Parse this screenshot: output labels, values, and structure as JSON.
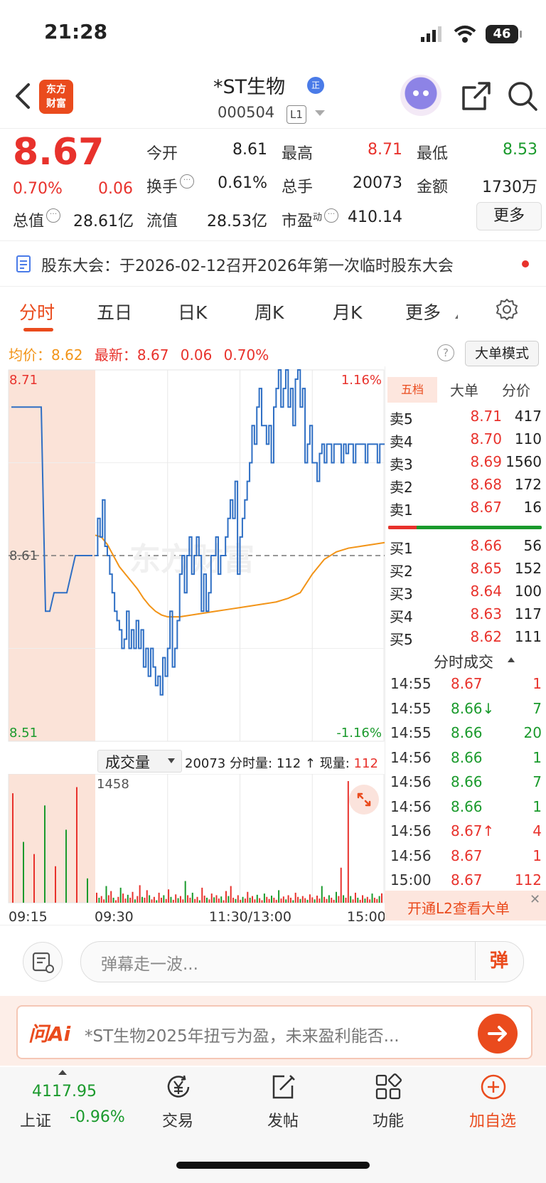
{
  "status_bar": {
    "time": "21:28",
    "battery": "46"
  },
  "header": {
    "logo_text": "东方\n财富",
    "title": "*ST生物",
    "title_badge": "正",
    "code": "000504",
    "level_badge": "L1"
  },
  "quote": {
    "price": "8.67",
    "change_pct": "0.70%",
    "change_amt": "0.06",
    "fields": {
      "open": {
        "label": "今开",
        "value": "8.61"
      },
      "high": {
        "label": "最高",
        "value": "8.71"
      },
      "low": {
        "label": "最低",
        "value": "8.53"
      },
      "turnover_rate": {
        "label": "换手",
        "value": "0.61%"
      },
      "volume": {
        "label": "总手",
        "value": "20073"
      },
      "amount": {
        "label": "金额",
        "value": "1730万"
      },
      "total_mkt_cap": {
        "label": "总值",
        "value": "28.61亿"
      },
      "float_mkt_cap": {
        "label": "流值",
        "value": "28.53亿"
      },
      "pe": {
        "label": "市盈",
        "label_sup": "动",
        "value": "410.14"
      }
    },
    "more_label": "更多"
  },
  "notice": {
    "text": "股东大会：于2026-02-12召开2026年第一次临时股东大会"
  },
  "tabs": [
    "分时",
    "五日",
    "日K",
    "周K",
    "月K",
    "更多"
  ],
  "chart_header": {
    "avg_label": "均价：",
    "avg_value": "8.62",
    "latest_label": "最新：",
    "latest_value": "8.67",
    "latest_chg": "0.06",
    "latest_pct": "0.70%",
    "info_icon": "?",
    "big_order_label": "大单模式"
  },
  "chart_data": {
    "type": "line",
    "y_max_label": "8.71",
    "y_mid_label": "8.61",
    "y_min_label": "8.51",
    "pct_max_label": "1.16%",
    "pct_min_label": "-1.16%",
    "ylim": [
      8.51,
      8.71
    ],
    "prev_close": 8.61,
    "watermark": "东方财富",
    "x_labels": [
      "09:15",
      "09:30",
      "11:30/13:00",
      "15:00"
    ],
    "series": [
      {
        "name": "均价",
        "color": "#f29418",
        "x": [
          0,
          5,
          10,
          15,
          20,
          25,
          30,
          35,
          40,
          45,
          50,
          55,
          60,
          70,
          80,
          90,
          100,
          110,
          120,
          130,
          140,
          150,
          160,
          170,
          180,
          190,
          200,
          210,
          220,
          230,
          240
        ],
        "values": [
          8.621,
          8.62,
          8.616,
          8.61,
          8.604,
          8.6,
          8.596,
          8.592,
          8.587,
          8.583,
          8.58,
          8.578,
          8.577,
          8.577,
          8.578,
          8.579,
          8.58,
          8.581,
          8.582,
          8.583,
          8.584,
          8.585,
          8.587,
          8.59,
          8.6,
          8.608,
          8.612,
          8.614,
          8.615,
          8.616,
          8.617
        ]
      },
      {
        "name": "最新",
        "color": "#2f6fc4",
        "x": [
          0,
          2,
          4,
          6,
          8,
          10,
          12,
          14,
          16,
          18,
          20,
          22,
          24,
          26,
          28,
          30,
          32,
          34,
          36,
          38,
          40,
          42,
          44,
          46,
          48,
          50,
          52,
          54,
          56,
          58,
          60,
          62,
          64,
          66,
          68,
          70,
          72,
          74,
          76,
          78,
          80,
          82,
          84,
          86,
          88,
          90,
          92,
          94,
          96,
          98,
          100,
          102,
          104,
          106,
          108,
          110,
          112,
          114,
          116,
          118,
          120,
          122,
          124,
          126,
          128,
          130,
          132,
          134,
          136,
          138,
          140,
          142,
          144,
          146,
          148,
          150,
          152,
          154,
          156,
          158,
          160,
          162,
          164,
          166,
          168,
          170,
          172,
          174,
          176,
          178,
          180,
          182,
          184,
          186,
          188,
          190,
          192,
          194,
          196,
          198,
          200,
          202,
          204,
          206,
          208,
          210,
          212,
          214,
          216,
          218,
          220,
          222,
          224,
          226,
          228,
          230,
          232,
          234,
          236,
          238,
          240
        ],
        "values": [
          8.61,
          8.63,
          8.62,
          8.64,
          8.615,
          8.61,
          8.6,
          8.59,
          8.58,
          8.575,
          8.57,
          8.56,
          8.565,
          8.58,
          8.56,
          8.57,
          8.56,
          8.575,
          8.56,
          8.57,
          8.55,
          8.56,
          8.545,
          8.56,
          8.55,
          8.54,
          8.545,
          8.535,
          8.555,
          8.545,
          8.56,
          8.58,
          8.55,
          8.56,
          8.575,
          8.6,
          8.61,
          8.59,
          8.61,
          8.62,
          8.6,
          8.61,
          8.62,
          8.61,
          8.58,
          8.6,
          8.58,
          8.59,
          8.61,
          8.61,
          8.62,
          8.6,
          8.61,
          8.61,
          8.62,
          8.63,
          8.64,
          8.63,
          8.65,
          8.6,
          8.62,
          8.63,
          8.64,
          8.65,
          8.66,
          8.68,
          8.67,
          8.69,
          8.7,
          8.68,
          8.68,
          8.67,
          8.68,
          8.66,
          8.69,
          8.7,
          8.71,
          8.69,
          8.7,
          8.71,
          8.69,
          8.7,
          8.68,
          8.705,
          8.71,
          8.69,
          8.7,
          8.66,
          8.67,
          8.68,
          8.66,
          8.66,
          8.65,
          8.665,
          8.67,
          8.66,
          8.67,
          8.67,
          8.66,
          8.67,
          8.67,
          8.67,
          8.66,
          8.67,
          8.665,
          8.67,
          8.67,
          8.66,
          8.67,
          8.67,
          8.67,
          8.67,
          8.66,
          8.67,
          8.67,
          8.67,
          8.67,
          8.66,
          8.67,
          8.67,
          8.67
        ]
      }
    ],
    "auction_values": [
      8.69,
      8.69,
      8.69,
      8.69,
      8.69,
      8.69,
      8.69,
      8.69,
      8.58,
      8.58,
      8.59,
      8.59,
      8.59,
      8.59,
      8.6,
      8.61,
      8.61,
      8.61,
      8.61,
      8.61
    ],
    "volume": {
      "label": "成交量",
      "total_value": "20073",
      "interval_label": "分时量:",
      "interval_value": "112",
      "current_label": "现量:",
      "current_value": "112",
      "max_label": "1458",
      "ymax": 1458,
      "bars": [
        120,
        60,
        80,
        40,
        200,
        90,
        140,
        60,
        30,
        70,
        180,
        110,
        50,
        95,
        60,
        130,
        40,
        80,
        210,
        70,
        60,
        150,
        90,
        40,
        70,
        30,
        120,
        60,
        90,
        45,
        160,
        70,
        35,
        100,
        55,
        80,
        40,
        260,
        90,
        60,
        120,
        45,
        70,
        30,
        180,
        85,
        60,
        40,
        110,
        65,
        90,
        50,
        75,
        30,
        140,
        80,
        200,
        60,
        45,
        90,
        35,
        70,
        50,
        130,
        60,
        80,
        40,
        95,
        55,
        30,
        110,
        70,
        45,
        85,
        60,
        35,
        150,
        50,
        75,
        40,
        90,
        60,
        30,
        120,
        70,
        45,
        80,
        55,
        35,
        100,
        65,
        40,
        85,
        50,
        200,
        70,
        45,
        90,
        60,
        35,
        130,
        80,
        420,
        90,
        60,
        1458,
        80,
        40,
        120,
        60,
        35,
        90,
        50,
        70,
        40,
        110,
        60,
        45,
        80,
        112
      ],
      "bar_colors": "alternating"
    }
  },
  "order_book": {
    "tabs": [
      "五档",
      "大单",
      "分价"
    ],
    "asks": [
      {
        "label": "卖5",
        "price": "8.71",
        "vol": "417"
      },
      {
        "label": "卖4",
        "price": "8.70",
        "vol": "110"
      },
      {
        "label": "卖3",
        "price": "8.69",
        "vol": "1560"
      },
      {
        "label": "卖2",
        "price": "8.68",
        "vol": "172"
      },
      {
        "label": "卖1",
        "price": "8.67",
        "vol": "16"
      }
    ],
    "bids": [
      {
        "label": "买1",
        "price": "8.66",
        "vol": "56"
      },
      {
        "label": "买2",
        "price": "8.65",
        "vol": "152"
      },
      {
        "label": "买3",
        "price": "8.64",
        "vol": "100"
      },
      {
        "label": "买4",
        "price": "8.63",
        "vol": "117"
      },
      {
        "label": "买5",
        "price": "8.62",
        "vol": "111"
      }
    ]
  },
  "ticks": {
    "title": "分时成交",
    "rows": [
      {
        "time": "14:55",
        "price": "8.67",
        "arrow": "",
        "vol": "1",
        "color": "red"
      },
      {
        "time": "14:55",
        "price": "8.66",
        "arrow": "↓",
        "vol": "7",
        "color": "green"
      },
      {
        "time": "14:55",
        "price": "8.66",
        "arrow": "",
        "vol": "20",
        "color": "green"
      },
      {
        "time": "14:56",
        "price": "8.66",
        "arrow": "",
        "vol": "1",
        "color": "green"
      },
      {
        "time": "14:56",
        "price": "8.66",
        "arrow": "",
        "vol": "7",
        "color": "green"
      },
      {
        "time": "14:56",
        "price": "8.66",
        "arrow": "",
        "vol": "1",
        "color": "green"
      },
      {
        "time": "14:56",
        "price": "8.67",
        "arrow": "↑",
        "vol": "4",
        "color": "red"
      },
      {
        "time": "14:56",
        "price": "8.67",
        "arrow": "",
        "vol": "1",
        "color": "red"
      },
      {
        "time": "15:00",
        "price": "8.67",
        "arrow": "",
        "vol": "112",
        "color": "red"
      }
    ],
    "l2_banner": "开通L2查看大单",
    "l2_close": "✕"
  },
  "danmu": {
    "placeholder": "弹幕走一波...",
    "send_label": "弹"
  },
  "ask_ai": {
    "logo": "问Ai",
    "text": "*ST生物2025年扭亏为盈，未来盈利能否..."
  },
  "bottom_nav": {
    "index_value": "4117.95",
    "index_name": "上证",
    "index_chg": "-0.96%",
    "items": [
      {
        "label": "交易",
        "icon": "yen-icon"
      },
      {
        "label": "发帖",
        "icon": "edit-icon"
      },
      {
        "label": "功能",
        "icon": "grid-icon"
      },
      {
        "label": "加自选",
        "icon": "plus-circle-icon"
      }
    ]
  },
  "colors": {
    "up": "#e8322c",
    "down": "#1a9a2c",
    "brand": "#ea4b1d",
    "avg_line": "#f29418",
    "price_line": "#2f6fc4"
  }
}
